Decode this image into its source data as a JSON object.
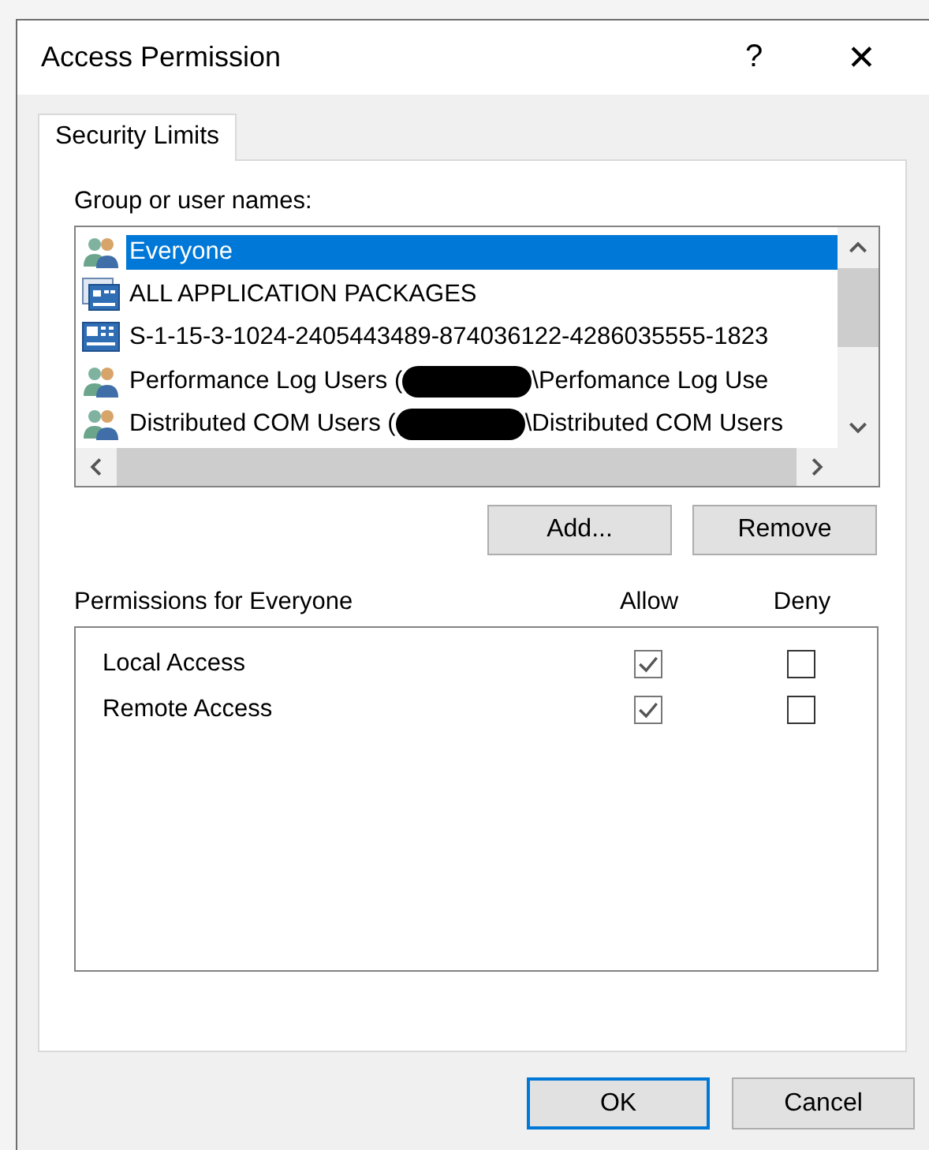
{
  "window": {
    "title": "Access Permission",
    "help": "?",
    "close": "✕"
  },
  "tabs": [
    {
      "label": "Security Limits",
      "selected": true
    }
  ],
  "group_label": "Group or user names:",
  "users": [
    {
      "kind": "group",
      "name": "Everyone",
      "selected": true
    },
    {
      "kind": "package",
      "name": "ALL APPLICATION PACKAGES",
      "selected": false
    },
    {
      "kind": "sid",
      "name": "S-1-15-3-1024-2405443489-874036122-4286035555-1823",
      "selected": false
    },
    {
      "kind": "group",
      "name": "Performance Log Users (",
      "redacted": true,
      "suffix": "\\Perfomance Log Use",
      "selected": false
    },
    {
      "kind": "group",
      "name": "Distributed COM Users (",
      "redacted": true,
      "suffix": "\\Distributed COM Users",
      "selected": false
    }
  ],
  "user_buttons": [
    "Add...",
    "Remove"
  ],
  "permissions": {
    "title": "Permissions for Everyone",
    "allow_header": "Allow",
    "deny_header": "Deny",
    "rows": [
      {
        "name": "Local Access",
        "allow": true,
        "deny": false
      },
      {
        "name": "Remote Access",
        "allow": true,
        "deny": false
      }
    ]
  },
  "buttons": [
    {
      "label": "OK",
      "default": true
    },
    {
      "label": "Cancel",
      "default": false
    }
  ]
}
